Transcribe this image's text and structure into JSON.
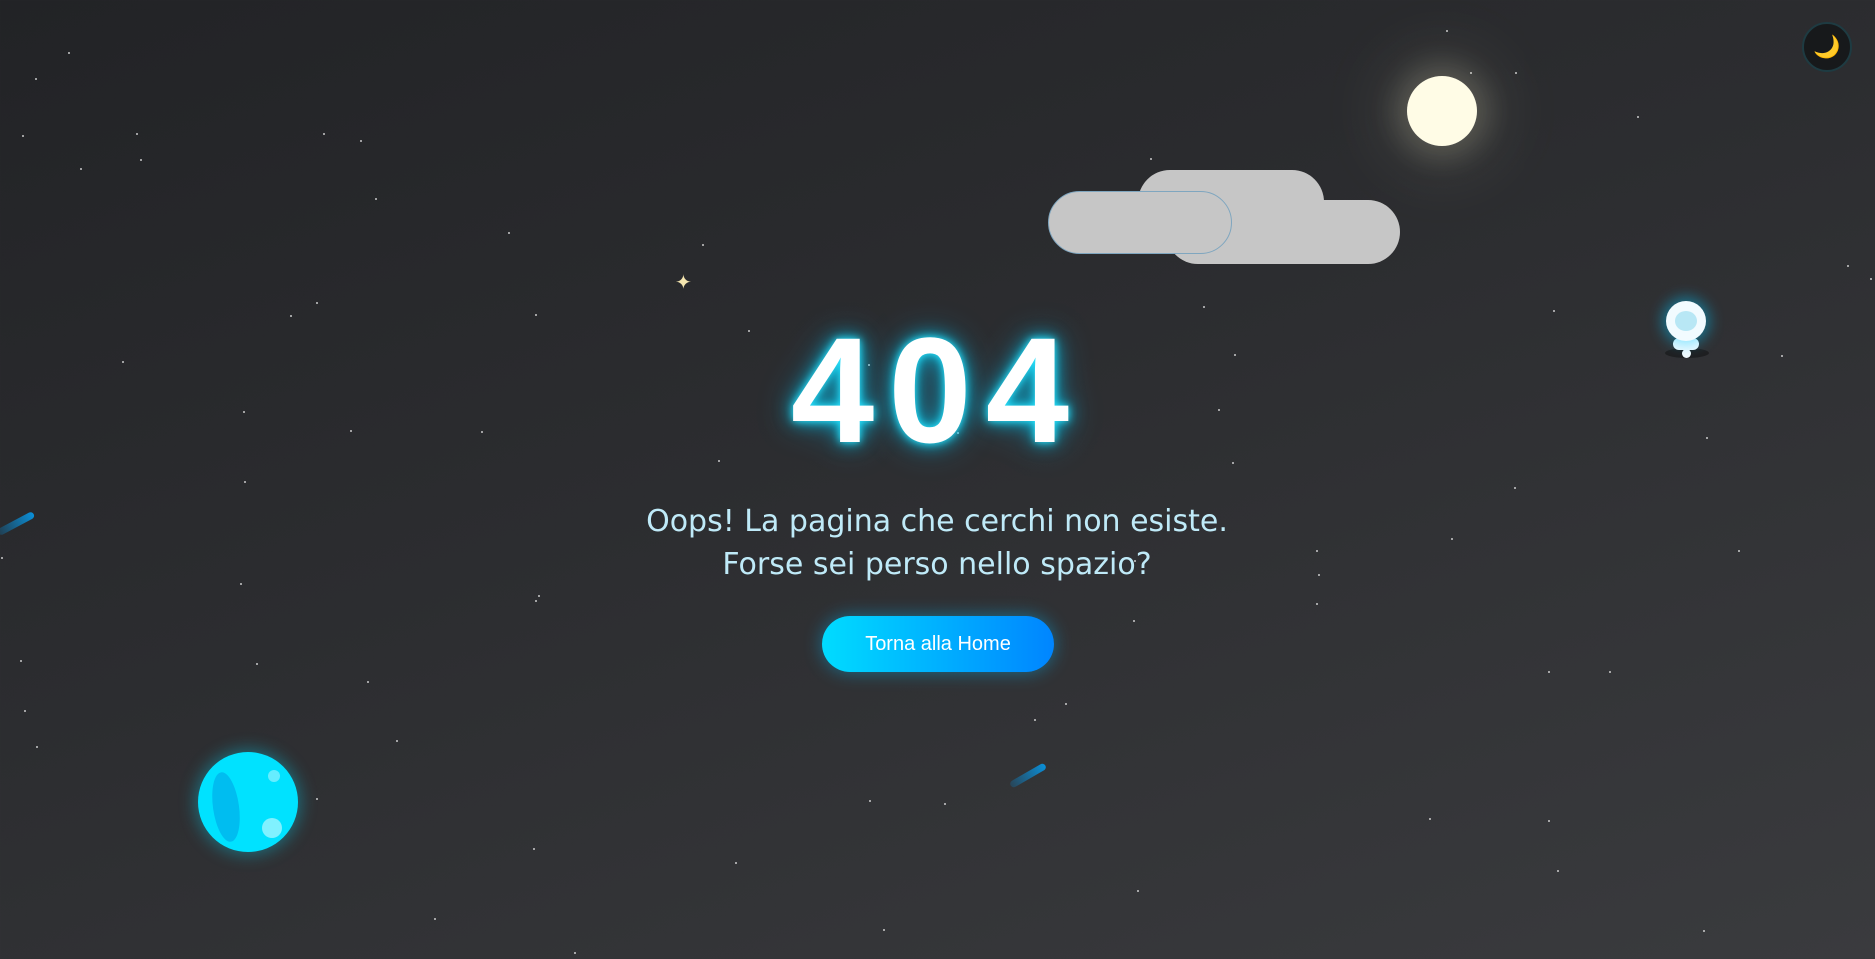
{
  "error": {
    "code": "404",
    "message_line1": "Oops! La pagina che cerchi non esiste.",
    "message_line2": "Forse sei perso nello spazio?"
  },
  "actions": {
    "home_button_label": "Torna alla Home"
  },
  "theme_toggle": {
    "icon": "crescent-moon-icon",
    "glyph": "🌙"
  },
  "decorations": {
    "twinkle_glyph": "✦"
  },
  "colors": {
    "accent": "#00dcff",
    "button_gradient_end": "#0085ff",
    "message_text": "#bfeaf8",
    "background": "#2c2d30"
  }
}
